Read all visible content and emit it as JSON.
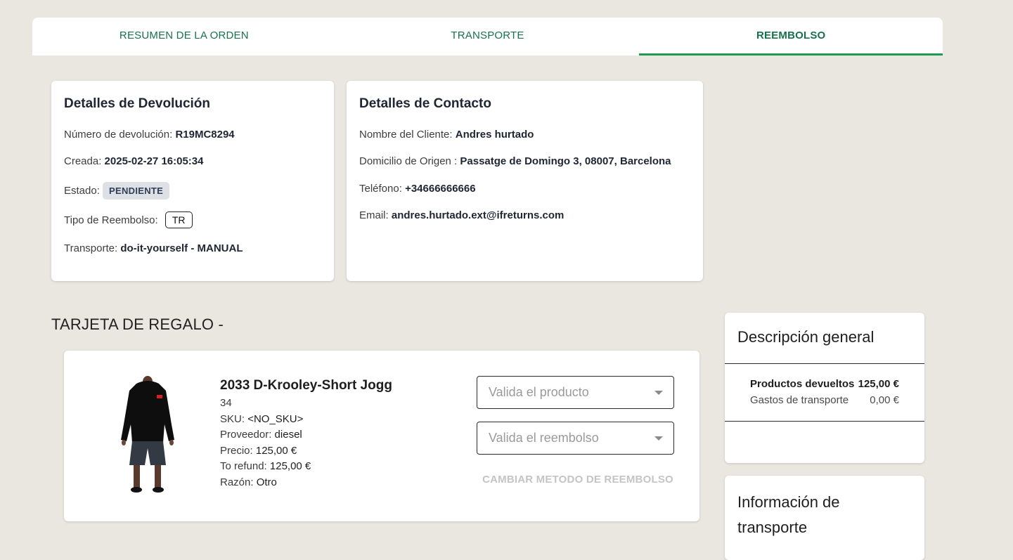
{
  "tabs": [
    {
      "label": "RESUMEN DE LA ORDEN"
    },
    {
      "label": "TRANSPORTE"
    },
    {
      "label": "REEMBOLSO"
    }
  ],
  "return_details": {
    "title": "Detalles de Devolución",
    "number_label": "Número de devolución:",
    "number_value": "R19MC8294",
    "created_label": "Creada:",
    "created_value": "2025-02-27 16:05:34",
    "status_label": "Estado:",
    "status_value": "PENDIENTE",
    "refund_type_label": "Tipo de Reembolso:",
    "refund_type_value": "TR",
    "transport_label": "Transporte:",
    "transport_value": "do-it-yourself - MANUAL"
  },
  "contact_details": {
    "title": "Detalles de Contacto",
    "name_label": "Nombre del Cliente:",
    "name_value": "Andres hurtado",
    "address_label": "Domicilio de Origen :",
    "address_value": "Passatge de Domingo 3, 08007, Barcelona",
    "phone_label": "Teléfono:",
    "phone_value": "+34666666666",
    "email_label": "Email:",
    "email_value": "andres.hurtado.ext@ifreturns.com"
  },
  "section_title": "TARJETA DE REGALO -",
  "product": {
    "name": "2033 D-Krooley-Short Jogg",
    "size": "34",
    "sku_label": "SKU:",
    "sku_value": "<NO_SKU>",
    "provider_label": "Proveedor:",
    "provider_value": "diesel",
    "price_label": "Precio:",
    "price_value": "125,00 €",
    "refund_label": "To refund:",
    "refund_value": "125,00 €",
    "reason_label": "Razón:",
    "reason_value": "Otro",
    "validate_product_placeholder": "Valida el producto",
    "validate_refund_placeholder": "Valida el reembolso",
    "change_method_label": "CAMBIAR METODO DE REEMBOLSO"
  },
  "summary": {
    "title": "Descripción general",
    "returned_label": "Productos devueltos",
    "returned_value": "125,00 €",
    "shipping_label": "Gastos de transporte",
    "shipping_value": "0,00 €"
  },
  "transport_info": {
    "title_line1": "Información de",
    "title_line2": "transporte"
  },
  "colors": {
    "accent": "#1f9a55",
    "tab_text": "#17714a",
    "background": "#eae6e0"
  }
}
